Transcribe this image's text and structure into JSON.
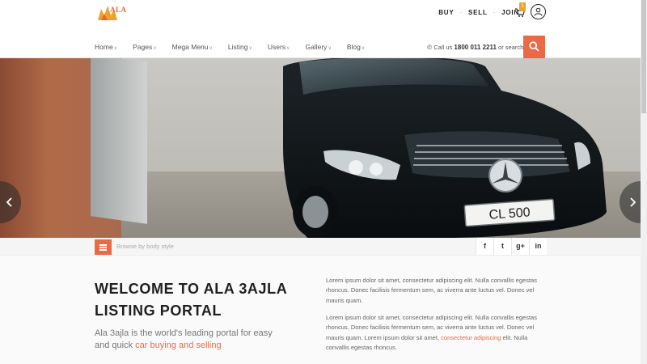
{
  "brand": {
    "logo_text": "ALA"
  },
  "topbar": {
    "links": [
      "BUY",
      "SELL",
      "JOIN"
    ],
    "cart_count": "1",
    "icons": {
      "cart": "cart-icon",
      "user": "user-icon"
    }
  },
  "nav": {
    "items": [
      "Home",
      "Pages",
      "Mega Menu",
      "Listing",
      "Users",
      "Gallery",
      "Blog"
    ],
    "call_prefix": "Call us",
    "phone": "1800 011 2211",
    "call_suffix": "or search"
  },
  "hero": {
    "plate": "CL 500"
  },
  "filterbar": {
    "browse_label": "Browse by body style",
    "social": [
      "f",
      "t",
      "g+",
      "in"
    ]
  },
  "welcome": {
    "title_line1": "WELCOME TO ALA 3AJLA",
    "title_line2": "LISTING PORTAL",
    "tagline_part1": "Ala 3ajla is the world's leading portal for easy and quick",
    "tagline_accent": "car buying and selling"
  },
  "paragraphs": {
    "p1": "Lorem ipsum dolor sit amet, consectetur adipiscing elit. Nulla convallis egestas rhoncus. Donec facilisis fermentum sem, ac viverra ante luctus vel. Donec vel mauris quam.",
    "p2_part1": "Lorem ipsum dolor sit amet, consectetur adipiscing elit. Nulla convallis egestas rhoncus. Donec facilisis fermentum sem, ac viverra ante luctus vel. Donec vel mauris quam. Lorem ipsum dolor sit amet,",
    "p2_accent": "consectetur adipiscing",
    "p2_part2": "elit. Nulla convallis egestas rhoncus."
  },
  "colors": {
    "accent": "#ea6a45",
    "badge": "#f0a12c"
  }
}
